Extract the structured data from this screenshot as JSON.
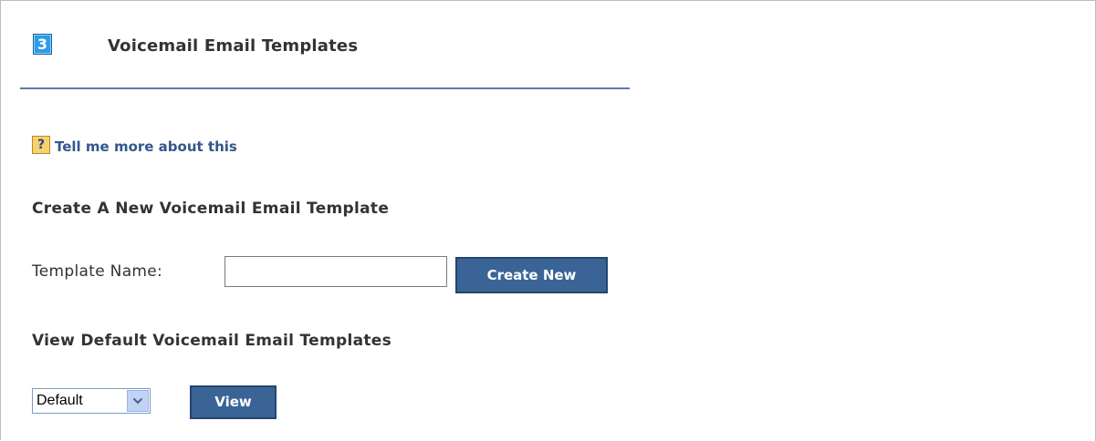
{
  "header": {
    "step_number": "3",
    "title": "Voicemail Email Templates"
  },
  "help": {
    "icon": "question-mark-icon",
    "link_text": "Tell me more about this"
  },
  "create_section": {
    "heading": "Create A New Voicemail Email Template",
    "template_label": "Template Name:",
    "template_value": "",
    "template_placeholder": "",
    "create_button": "Create New"
  },
  "view_section": {
    "heading": "View Default Voicemail Email Templates",
    "select_value": "Default",
    "view_button": "View"
  },
  "colors": {
    "accent": "#3a6496",
    "link": "#34568c",
    "divider": "#5a7aab",
    "step_icon": "#2f9be6"
  }
}
